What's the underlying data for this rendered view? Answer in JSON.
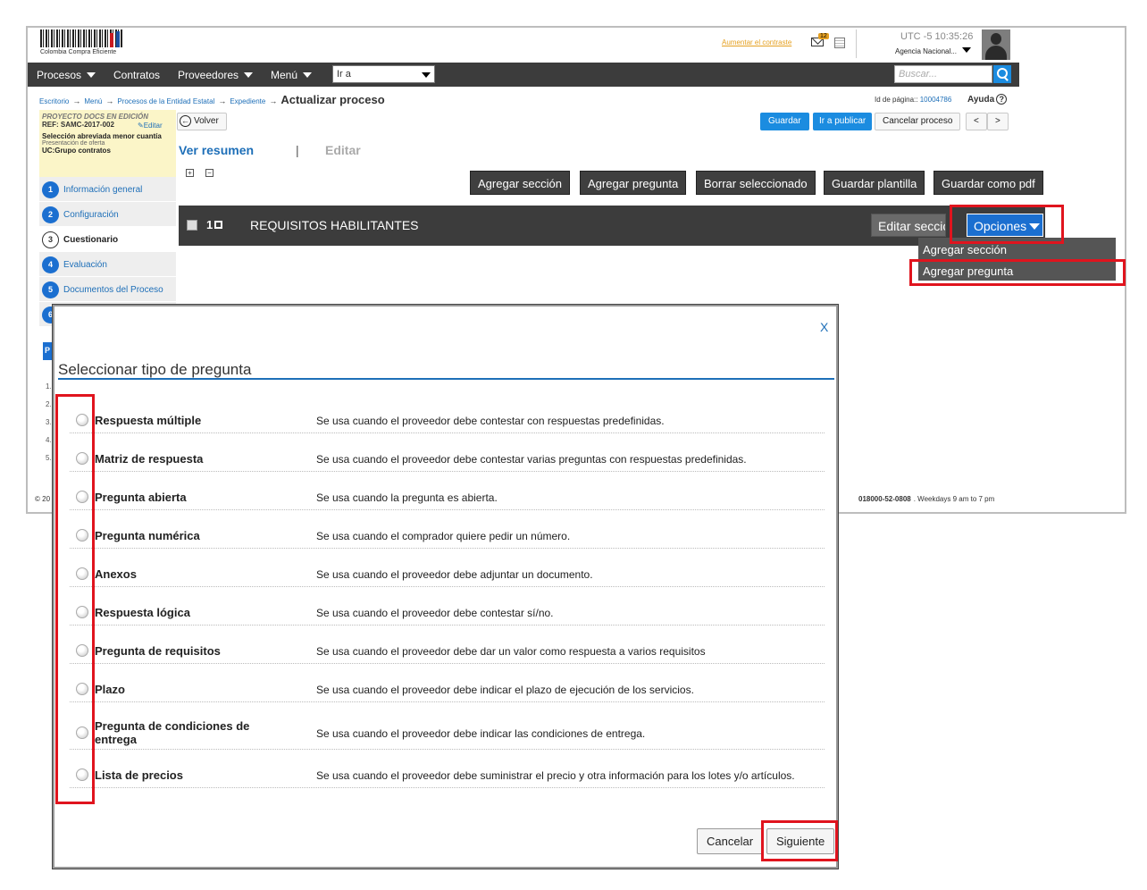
{
  "header": {
    "logo_text": "Colombia Compra Eficiente",
    "contrast_link": "Aumentar el contraste",
    "notifications_count": "12",
    "clock": "UTC -5 10:35:26",
    "agency": "Agencia Nacional..."
  },
  "navbar": {
    "items": [
      "Procesos",
      "Contratos",
      "Proveedores",
      "Menú"
    ],
    "goto_placeholder": "Ir a",
    "search_placeholder": "Buscar..."
  },
  "breadcrumb": {
    "items": [
      "Escritorio",
      "Menú",
      "Procesos de la Entidad Estatal",
      "Expediente"
    ],
    "current": "Actualizar proceso"
  },
  "page_id": {
    "label": "Id de página::",
    "value": "10004786"
  },
  "help_label": "Ayuda",
  "sidebar": {
    "status": "PROYECTO DOCS EN EDICIÓN",
    "ref": "REF: SAMC-2017-002",
    "edit_link": "Editar",
    "type": "Selección abreviada menor cuantía",
    "phase": "Presentación de oferta",
    "unit": "UC:Grupo contratos",
    "steps": [
      {
        "num": "1",
        "label": "Información general"
      },
      {
        "num": "2",
        "label": "Configuración"
      },
      {
        "num": "3",
        "label": "Cuestionario"
      },
      {
        "num": "4",
        "label": "Evaluación"
      },
      {
        "num": "5",
        "label": "Documentos del Proceso"
      },
      {
        "num": "6",
        "label": ""
      }
    ],
    "hidden_letter": "P",
    "hidden_nums": [
      "1.",
      "2.",
      "3.",
      "4.",
      "5."
    ]
  },
  "toolbar": {
    "back": "Volver",
    "save": "Guardar",
    "publish": "Ir a publicar",
    "cancel_process": "Cancelar proceso",
    "prev": "<",
    "next": ">"
  },
  "tabs": {
    "summary": "Ver resumen",
    "separator": "|",
    "edit": "Editar"
  },
  "actions": [
    "Agregar sección",
    "Agregar pregunta",
    "Borrar seleccionado",
    "Guardar plantilla",
    "Guardar como pdf"
  ],
  "section": {
    "number": "1",
    "title": "REQUISITOS HABILITANTES",
    "edit_button": "Editar sección",
    "options_button": "Opciones",
    "dropdown": [
      "Agregar sección",
      "Agregar pregunta"
    ]
  },
  "footer": {
    "left": "© 20",
    "phone": "018000-52-0808",
    "hours": ". Weekdays 9 am to 7 pm"
  },
  "modal": {
    "close": "X",
    "title": "Seleccionar tipo de pregunta",
    "questions": [
      {
        "name": "Respuesta múltiple",
        "desc": "Se usa cuando el proveedor debe contestar con respuestas predefinidas."
      },
      {
        "name": "Matriz de respuesta",
        "desc": "Se usa cuando el proveedor debe contestar varias preguntas con respuestas predefinidas."
      },
      {
        "name": "Pregunta abierta",
        "desc": "Se usa cuando la pregunta es abierta."
      },
      {
        "name": "Pregunta numérica",
        "desc": "Se usa cuando el comprador quiere pedir un número."
      },
      {
        "name": "Anexos",
        "desc": "Se usa cuando el proveedor debe adjuntar un documento."
      },
      {
        "name": "Respuesta lógica",
        "desc": "Se usa cuando el proveedor debe contestar sí/no."
      },
      {
        "name": "Pregunta de requisitos",
        "desc": "Se usa cuando el proveedor debe dar un valor como respuesta a varios requisitos"
      },
      {
        "name": "Plazo",
        "desc": "Se usa cuando el proveedor debe indicar el plazo de ejecución de los servicios."
      },
      {
        "name": "Pregunta de condiciones de entrega",
        "desc": "Se usa cuando el proveedor debe indicar las condiciones de entrega."
      },
      {
        "name": "Lista de precios",
        "desc": "Se usa cuando el proveedor debe suministrar el precio y otra información para los lotes y/o artículos."
      }
    ],
    "cancel": "Cancelar",
    "next": "Siguiente"
  },
  "colors": {
    "accent": "#1b8ce0",
    "highlight": "#e0141e",
    "navbar": "#3c3c3c"
  }
}
